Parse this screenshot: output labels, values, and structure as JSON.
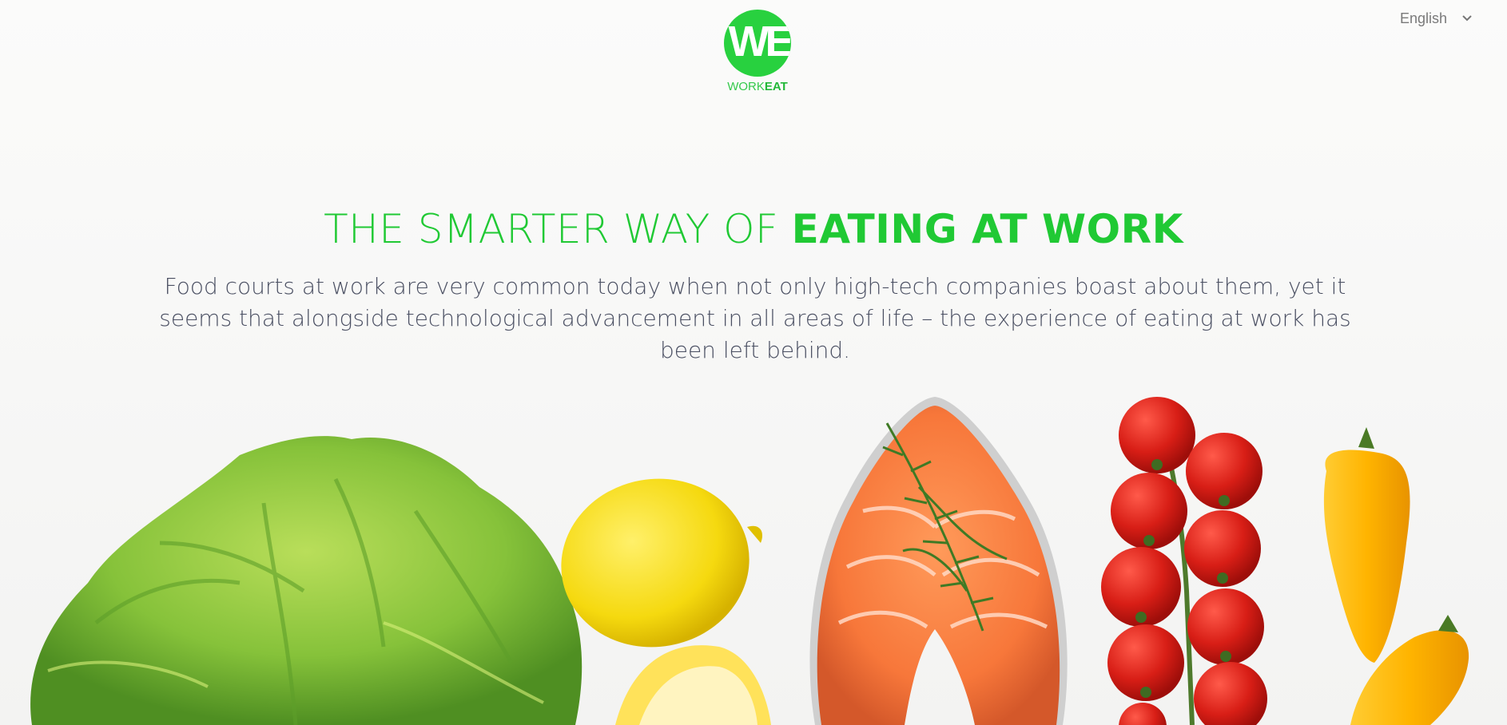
{
  "header": {
    "language": {
      "selected": "English",
      "icon": "chevron-down-icon"
    },
    "logo": {
      "monogram": "WE",
      "word_light": "WORK",
      "word_bold": "EAT"
    }
  },
  "hero": {
    "title_light": "THE SMARTER WAY OF ",
    "title_bold": "EATING AT WORK",
    "description": "Food courts at work are very common today when not only high-tech companies boast about them, yet it seems that alongside technological advancement in all areas of life – the experience of eating at work has been left behind."
  },
  "colors": {
    "brand_green": "#28d13f",
    "title_green": "#20c934",
    "body_text": "#4a4f62",
    "background": "#f8f8f7"
  },
  "illustration": {
    "items": [
      "lettuce",
      "lemon",
      "salmon-steak",
      "cherry-tomatoes",
      "yellow-peppers"
    ]
  }
}
